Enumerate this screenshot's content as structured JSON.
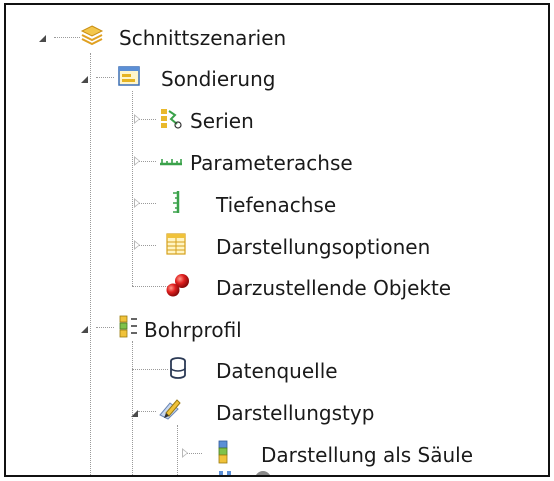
{
  "tree": {
    "items": [
      {
        "label": "Schnittszenarien",
        "icon": "layers-stack-icon",
        "expanded": true
      },
      {
        "label": "Sondierung",
        "icon": "window-panel-icon",
        "expanded": true
      },
      {
        "label": "Serien",
        "icon": "series-grid-icon",
        "expanded": false
      },
      {
        "label": "Parameterachse",
        "icon": "horizontal-axis-icon",
        "expanded": false
      },
      {
        "label": "Tiefenachse",
        "icon": "vertical-axis-icon",
        "expanded": false
      },
      {
        "label": "Darstellungsoptionen",
        "icon": "options-table-icon",
        "expanded": false
      },
      {
        "label": "Darzustellende Objekte",
        "icon": "red-spheres-icon",
        "expanded": null
      },
      {
        "label": "Bohrprofil",
        "icon": "borehole-profile-icon",
        "expanded": true
      },
      {
        "label": "Datenquelle",
        "icon": "database-icon",
        "expanded": null
      },
      {
        "label": "Darstellungstyp",
        "icon": "pencil-tool-icon",
        "expanded": true
      },
      {
        "label": "Darstellung als Säule",
        "icon": "column-bar-icon",
        "expanded": false
      }
    ]
  }
}
